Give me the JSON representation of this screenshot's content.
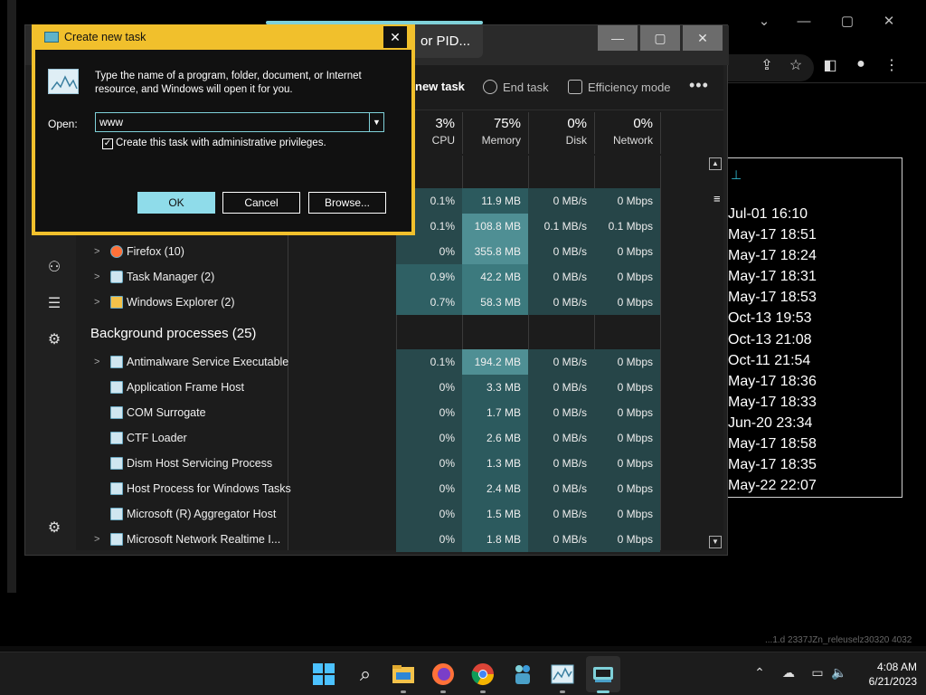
{
  "dialog": {
    "title": "Create new task",
    "close_glyph": "✕",
    "description": "Type the name of a program, folder, document, or Internet resource, and Windows will open it for you.",
    "open_label": "Open:",
    "open_value": "www",
    "admin_checkbox_checked": true,
    "admin_checkbox_label": "Create this task with administrative privileges.",
    "ok_label": "OK",
    "cancel_label": "Cancel",
    "browse_label": "Browse..."
  },
  "task_manager": {
    "search_text": "or PID...",
    "toolbar": {
      "run_new_task": "new task",
      "end_task": "End task",
      "efficiency_mode": "Efficiency mode",
      "more": "•••"
    },
    "columns": [
      {
        "pct": "3%",
        "label": "CPU"
      },
      {
        "pct": "75%",
        "label": "Memory"
      },
      {
        "pct": "0%",
        "label": "Disk"
      },
      {
        "pct": "0%",
        "label": "Network"
      }
    ],
    "app_rows": [
      {
        "name": "",
        "cpu": "0.1%",
        "memory": "11.9 MB",
        "disk": "0 MB/s",
        "network": "0 Mbps"
      },
      {
        "name": "",
        "cpu": "0.1%",
        "memory": "108.8 MB",
        "disk": "0.1 MB/s",
        "network": "0.1 Mbps"
      },
      {
        "name": "Firefox (10)",
        "cpu": "0%",
        "memory": "355.8 MB",
        "disk": "0 MB/s",
        "network": "0 Mbps"
      },
      {
        "name": "Task Manager (2)",
        "cpu": "0.9%",
        "memory": "42.2 MB",
        "disk": "0 MB/s",
        "network": "0 Mbps"
      },
      {
        "name": "Windows Explorer (2)",
        "cpu": "0.7%",
        "memory": "58.3 MB",
        "disk": "0 MB/s",
        "network": "0 Mbps"
      }
    ],
    "background_header": "Background processes (25)",
    "bg_rows": [
      {
        "name": "Antimalware Service Executable",
        "cpu": "0.1%",
        "memory": "194.2 MB",
        "disk": "0 MB/s",
        "network": "0 Mbps"
      },
      {
        "name": "Application Frame Host",
        "cpu": "0%",
        "memory": "3.3 MB",
        "disk": "0 MB/s",
        "network": "0 Mbps"
      },
      {
        "name": "COM Surrogate",
        "cpu": "0%",
        "memory": "1.7 MB",
        "disk": "0 MB/s",
        "network": "0 Mbps"
      },
      {
        "name": "CTF Loader",
        "cpu": "0%",
        "memory": "2.6 MB",
        "disk": "0 MB/s",
        "network": "0 Mbps"
      },
      {
        "name": "Dism Host Servicing Process",
        "cpu": "0%",
        "memory": "1.3 MB",
        "disk": "0 MB/s",
        "network": "0 Mbps"
      },
      {
        "name": "Host Process for Windows Tasks",
        "cpu": "0%",
        "memory": "2.4 MB",
        "disk": "0 MB/s",
        "network": "0 Mbps"
      },
      {
        "name": "Microsoft (R) Aggregator Host",
        "cpu": "0%",
        "memory": "1.5 MB",
        "disk": "0 MB/s",
        "network": "0 Mbps"
      },
      {
        "name": "Microsoft Network Realtime I...",
        "cpu": "0%",
        "memory": "1.8 MB",
        "disk": "0 MB/s",
        "network": "0 Mbps"
      }
    ]
  },
  "background_window": {
    "dates": [
      "Jul-01 16:10",
      "May-17 18:51",
      "May-17 18:24",
      "May-17 18:31",
      "May-17 18:53",
      "Oct-13 19:53",
      "Oct-13 21:08",
      "Oct-11 21:54",
      "May-17 18:36",
      "May-17 18:33",
      "Jun-20 23:34",
      "May-17 18:58",
      "May-17 18:35",
      "May-22 22:07"
    ],
    "footer_text": "...1.d 2337JZn_releuselz30320 4032"
  },
  "taskbar": {
    "time": "4:08 AM",
    "date": "6/21/2023"
  },
  "colors": {
    "dialog_accent": "#f1c02c",
    "highlight": "#7fd1d9",
    "heat_light": "#2f5a5e",
    "heat_mid": "#3f7a7f"
  }
}
